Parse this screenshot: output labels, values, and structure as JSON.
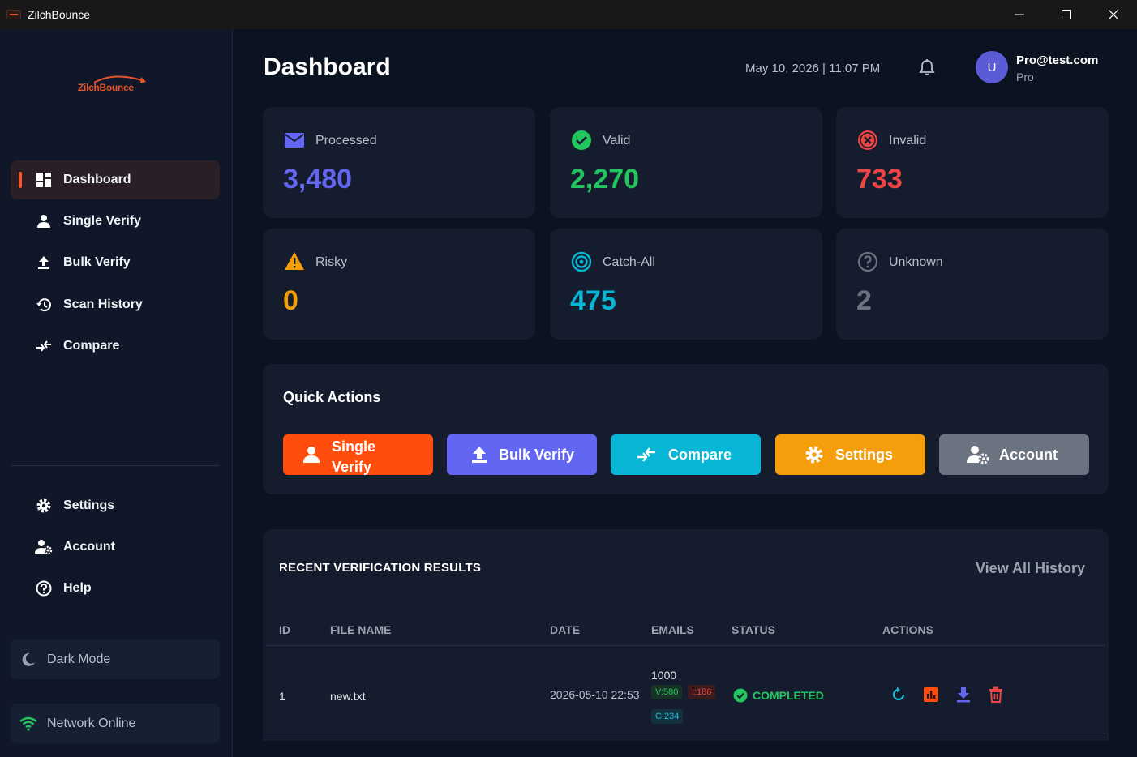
{
  "window": {
    "title": "ZilchBounce"
  },
  "brand": {
    "logo_text": "ZilchBounce"
  },
  "sidebar": {
    "items": [
      {
        "label": "Dashboard",
        "icon": "dashboard-icon",
        "active": true
      },
      {
        "label": "Single Verify",
        "icon": "user-icon"
      },
      {
        "label": "Bulk Verify",
        "icon": "upload-icon"
      },
      {
        "label": "Scan History",
        "icon": "history-icon"
      },
      {
        "label": "Compare",
        "icon": "compare-arrows-icon"
      }
    ],
    "bottom_items": [
      {
        "label": "Settings",
        "icon": "gear-icon"
      },
      {
        "label": "Account",
        "icon": "account-settings-icon"
      },
      {
        "label": "Help",
        "icon": "help-icon"
      }
    ],
    "dark_mode_label": "Dark Mode",
    "network_label": "Network Online"
  },
  "header": {
    "title": "Dashboard",
    "datetime": "May 10, 2026 | 11:07 PM",
    "user": {
      "initial": "U",
      "email": "Pro@test.com",
      "plan": "Pro"
    }
  },
  "stats": [
    {
      "label": "Processed",
      "value": "3,480",
      "color": "#6366f1",
      "icon": "envelope-icon"
    },
    {
      "label": "Valid",
      "value": "2,270",
      "color": "#22c55e",
      "icon": "check-circle-icon"
    },
    {
      "label": "Invalid",
      "value": "733",
      "color": "#ef4444",
      "icon": "x-circle-icon"
    },
    {
      "label": "Risky",
      "value": "0",
      "color": "#f59e0b",
      "icon": "warning-icon"
    },
    {
      "label": "Catch-All",
      "value": "475",
      "color": "#06b6d4",
      "icon": "target-icon"
    },
    {
      "label": "Unknown",
      "value": "2",
      "color": "#6b7280",
      "icon": "question-circle-icon"
    }
  ],
  "quick_actions": {
    "title": "Quick Actions",
    "buttons": [
      {
        "label_line1": "Single",
        "label_line2": "Verify",
        "color": "#ff4d0d",
        "icon": "user-icon"
      },
      {
        "label": "Bulk Verify",
        "color": "#6366f1",
        "icon": "upload-icon"
      },
      {
        "label": "Compare",
        "color": "#06b6d4",
        "icon": "compare-arrows-icon"
      },
      {
        "label": "Settings",
        "color": "#f59e0b",
        "icon": "gear-icon"
      },
      {
        "label": "Account",
        "color": "#6b7280",
        "icon": "account-settings-icon"
      }
    ]
  },
  "results": {
    "title": "RECENT VERIFICATION RESULTS",
    "view_all": "View All History",
    "columns": [
      "ID",
      "FILE NAME",
      "DATE",
      "EMAILS",
      "STATUS",
      "ACTIONS"
    ],
    "rows": [
      {
        "id": "1",
        "file": "new.txt",
        "date": "2026-05-10 22:53",
        "emails": "1000",
        "valid_tag": "V:580",
        "invalid_tag": "I:186",
        "catchall_tag": "C:234",
        "status": "COMPLETED"
      }
    ]
  }
}
